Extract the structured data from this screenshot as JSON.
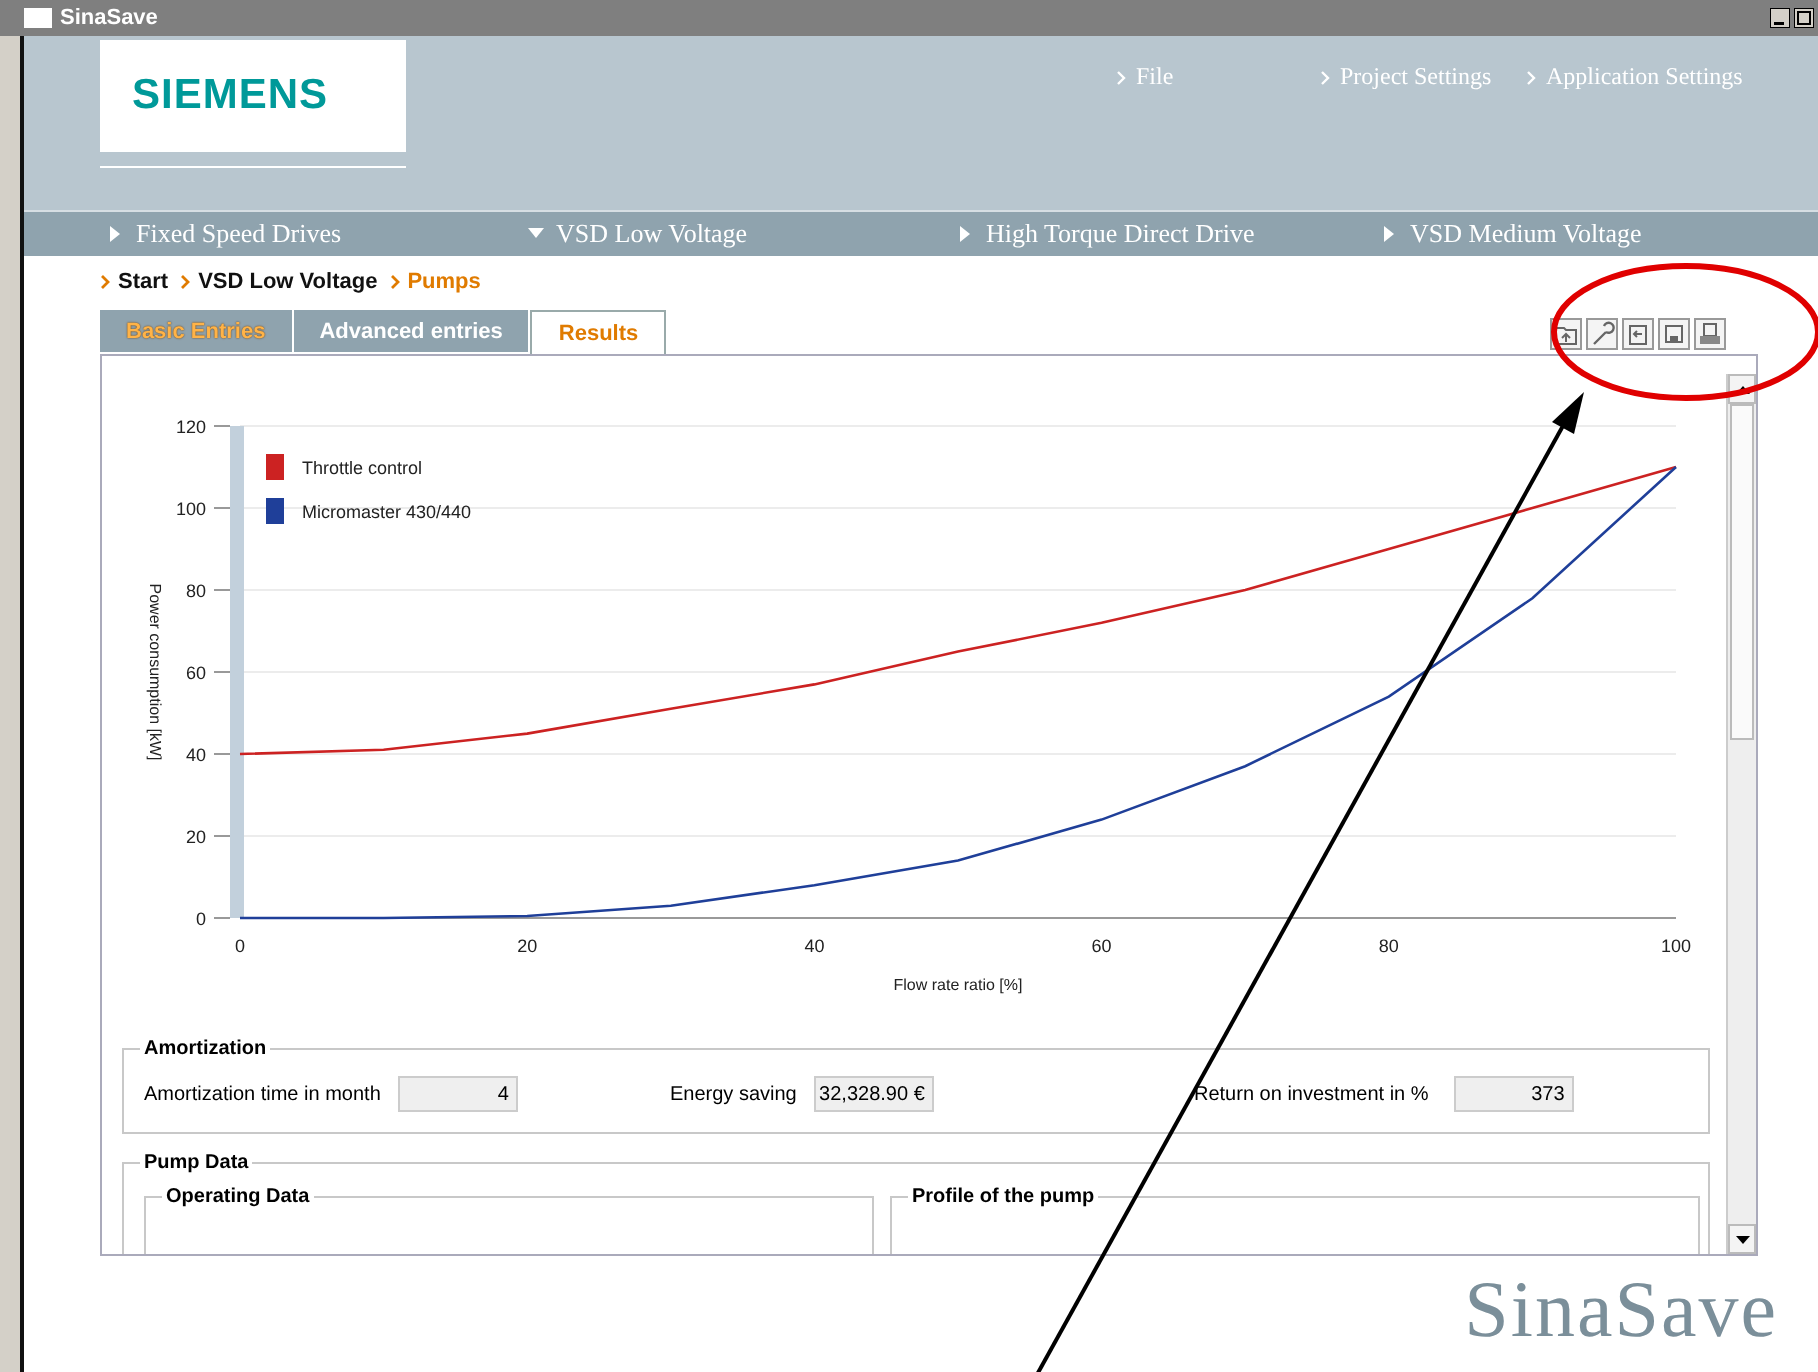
{
  "window": {
    "title": "SinaSave"
  },
  "header": {
    "logo": "SIEMENS",
    "menu": [
      "File",
      "Project Settings",
      "Application Settings"
    ]
  },
  "nav": [
    {
      "label": "Fixed Speed Drives",
      "expanded": false
    },
    {
      "label": "VSD Low Voltage",
      "expanded": true
    },
    {
      "label": "High Torque Direct Drive",
      "expanded": false
    },
    {
      "label": "VSD Medium Voltage",
      "expanded": false
    }
  ],
  "breadcrumb": [
    {
      "label": "Start",
      "selected": false
    },
    {
      "label": "VSD Low Voltage",
      "selected": false
    },
    {
      "label": "Pumps",
      "selected": true
    }
  ],
  "tabs": [
    {
      "label": "Basic Entries",
      "selected": false,
      "completed": true
    },
    {
      "label": "Advanced entries",
      "selected": false,
      "completed": false
    },
    {
      "label": "Results",
      "selected": true,
      "completed": false
    }
  ],
  "chart_data": {
    "type": "line",
    "grid": true,
    "legend": true,
    "xlabel": "Flow rate ratio [%]",
    "ylabel": "Power consumption [kW]",
    "x": [
      0,
      10,
      20,
      30,
      40,
      50,
      60,
      70,
      80,
      90,
      100
    ],
    "xlim": [
      0,
      100
    ],
    "ylim": [
      0,
      120
    ],
    "xticks": [
      0,
      20,
      40,
      60,
      80,
      100
    ],
    "yticks": [
      0,
      20,
      40,
      60,
      80,
      100,
      120
    ],
    "series": [
      {
        "name": "Throttle control",
        "color": "#cc2222",
        "values": [
          40,
          41,
          45,
          51,
          57,
          65,
          72,
          80,
          90,
          100,
          110
        ]
      },
      {
        "name": "Micromaster 430/440",
        "color": "#1f3f99",
        "values": [
          0,
          0,
          0.5,
          3,
          8,
          14,
          24,
          37,
          54,
          78,
          110
        ]
      }
    ]
  },
  "amortization": {
    "title": "Amortization",
    "fields": [
      {
        "label": "Amortization time in month",
        "value": "4"
      },
      {
        "label": "Energy saving",
        "value": "32,328.90 €"
      },
      {
        "label": "Return on investment in %",
        "value": "373"
      }
    ]
  },
  "pump_data": {
    "title": "Pump Data",
    "groups": [
      "Operating Data",
      "Profile of the pump"
    ]
  },
  "footer": {
    "brand": "SinaSave"
  }
}
